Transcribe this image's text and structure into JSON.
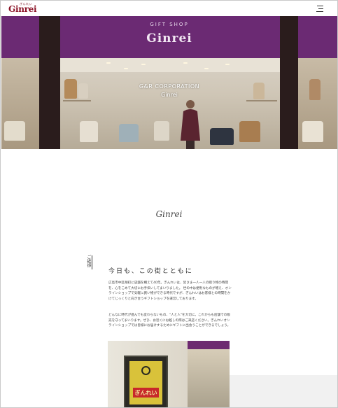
{
  "header": {
    "logo_kana": "ぎんれい",
    "logo_text": "Ginrei",
    "menu_icon": "hamburger-menu-icon"
  },
  "hero": {
    "sign_sub": "GIFT SHOP",
    "sign_title": "Ginrei",
    "corp_name": "G&R CORPORATION",
    "corp_sub": "Ginrei"
  },
  "content": {
    "signature": "Ginrei",
    "side_label": "ご挨拶",
    "section_title": "今日も、この街とともに",
    "paragraph_1": "広島市中区胡町に店舗を構えて40年。ぎんれいは、皆さま一人一人の贈り物の時間を、心をこめて大切にお手伝いしてまいりました。 世の中は便利なものが増え、オンラインショップで気軽に買い物ができる時代ですが、ぎんれいはお客様との時間をかけてじっくりと向き合うギフトショップを運営しております。",
    "paragraph_2": "どんなに時代が進んでも変わらないもの、\"人と人\"を大切に。これからも店舗での販売を守ってまいります。ぜひ、お近くにお越しの際はご来店ください。ぎんれいオンラインショップでは皆様にお届けするためにギフトに出会うことができるでしょう。"
  },
  "photo": {
    "sign_text": "ぎんれい"
  },
  "colors": {
    "brand": "#8a1024",
    "purple": "#6b2a73"
  }
}
